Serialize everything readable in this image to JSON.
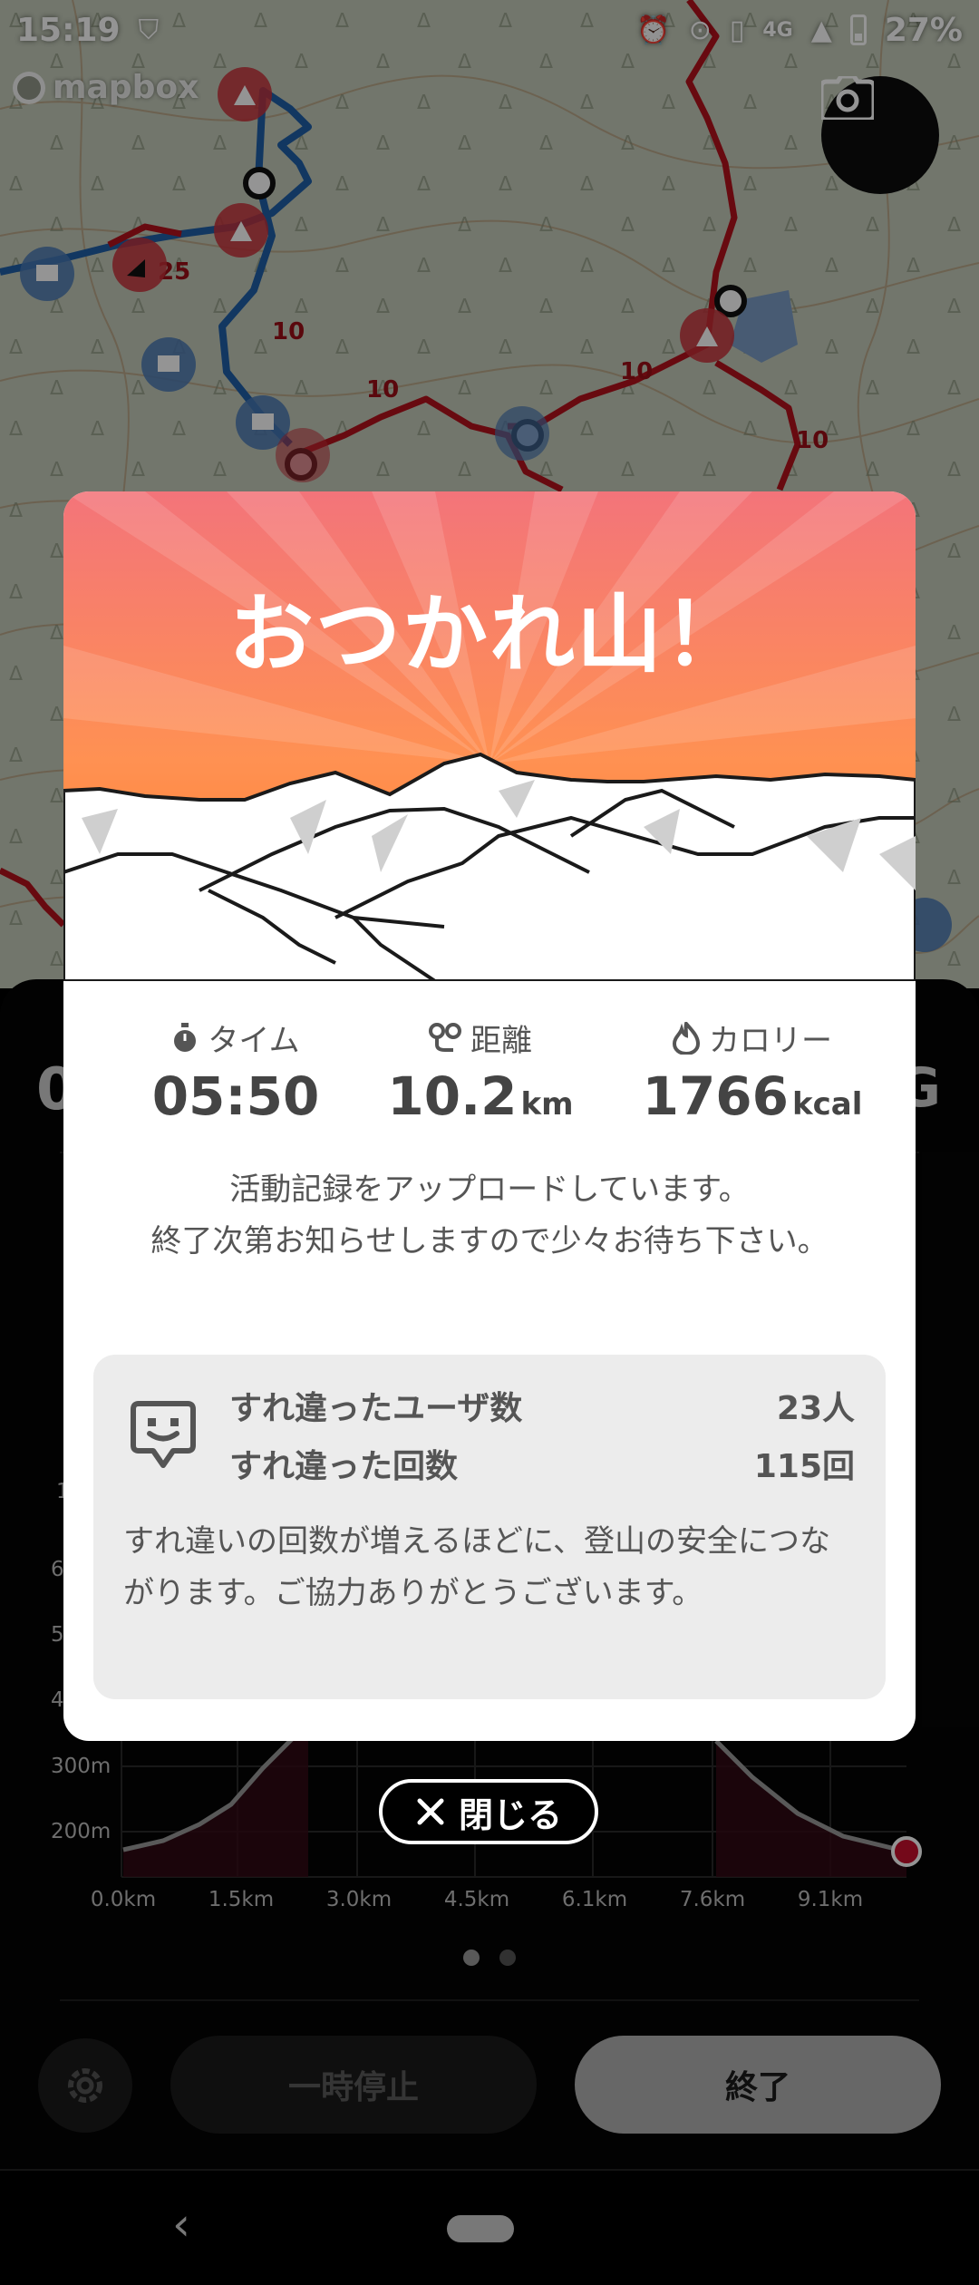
{
  "status_bar": {
    "time": "15:19",
    "network": "4G",
    "battery": "27%"
  },
  "map": {
    "attribution": "mapbox",
    "trail_labels": [
      "25",
      "10",
      "10",
      "10",
      "10"
    ]
  },
  "panel": {
    "time_partial": "0",
    "right_partial": "G",
    "elevation_labels": [
      "1",
      "6",
      "5",
      "4",
      "300m",
      "200m"
    ],
    "distance_labels": [
      "0.0km",
      "1.5km",
      "3.0km",
      "4.5km",
      "6.1km",
      "7.6km",
      "9.1km"
    ],
    "pause_label": "一時停止",
    "end_label": "終了"
  },
  "modal": {
    "title": "おつかれ山！",
    "stats": {
      "time_label": "タイム",
      "time_value": "05:50",
      "distance_label": "距離",
      "distance_value": "10.2",
      "distance_unit": "km",
      "calorie_label": "カロリー",
      "calorie_value": "1766",
      "calorie_unit": "kcal"
    },
    "upload_line1": "活動記録をアップロードしています。",
    "upload_line2": "終了次第お知らせしますので少々お待ち下さい。",
    "passing": {
      "users_label": "すれ違ったユーザ数",
      "users_value": "23人",
      "count_label": "すれ違った回数",
      "count_value": "115回",
      "note": "すれ違いの回数が増えるほどに、登山の安全につながります。ご協力ありがとうございます。"
    }
  },
  "close_button": {
    "label": "閉じる"
  },
  "colors": {
    "accent_orange": "#ff7a3a",
    "trail_red": "#c8102e",
    "trail_blue": "#1f5fa8"
  }
}
